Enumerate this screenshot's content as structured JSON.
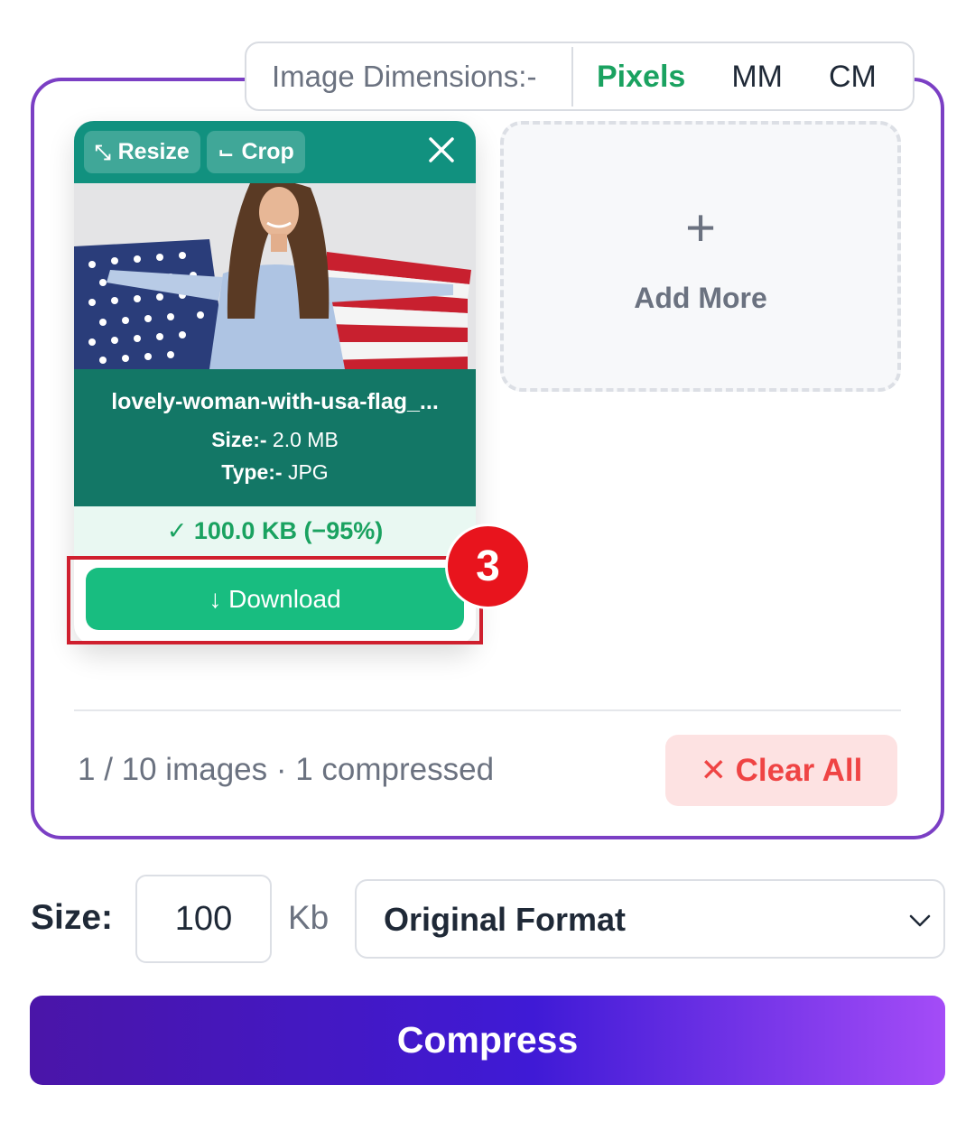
{
  "dimensions": {
    "label": "Image Dimensions:-",
    "options": [
      "Pixels",
      "MM",
      "CM"
    ],
    "active": "Pixels",
    "active_color": "#1aa260"
  },
  "card": {
    "resize_label": "Resize",
    "crop_label": "Crop",
    "filename": "lovely-woman-with-usa-flag_...",
    "size_label": "Size:-",
    "size_value": "2.0 MB",
    "type_label": "Type:-",
    "type_value": "JPG",
    "result": "✓ 100.0 KB (−95%)",
    "download_label": "↓ Download",
    "header_color": "#11917f",
    "info_color": "#137766"
  },
  "annotation": {
    "step_number": "3",
    "color": "#e8141d"
  },
  "add_more": {
    "plus": "+",
    "label": "Add More"
  },
  "footer": {
    "count_text": "1 / 10 images · 1 compressed",
    "clear_label": "✕ Clear All"
  },
  "controls": {
    "size_label": "Size:",
    "size_value": "100",
    "unit": "Kb",
    "format_value": "Original Format",
    "compress_label": "Compress"
  },
  "accent_purple": "#7b3fc4"
}
